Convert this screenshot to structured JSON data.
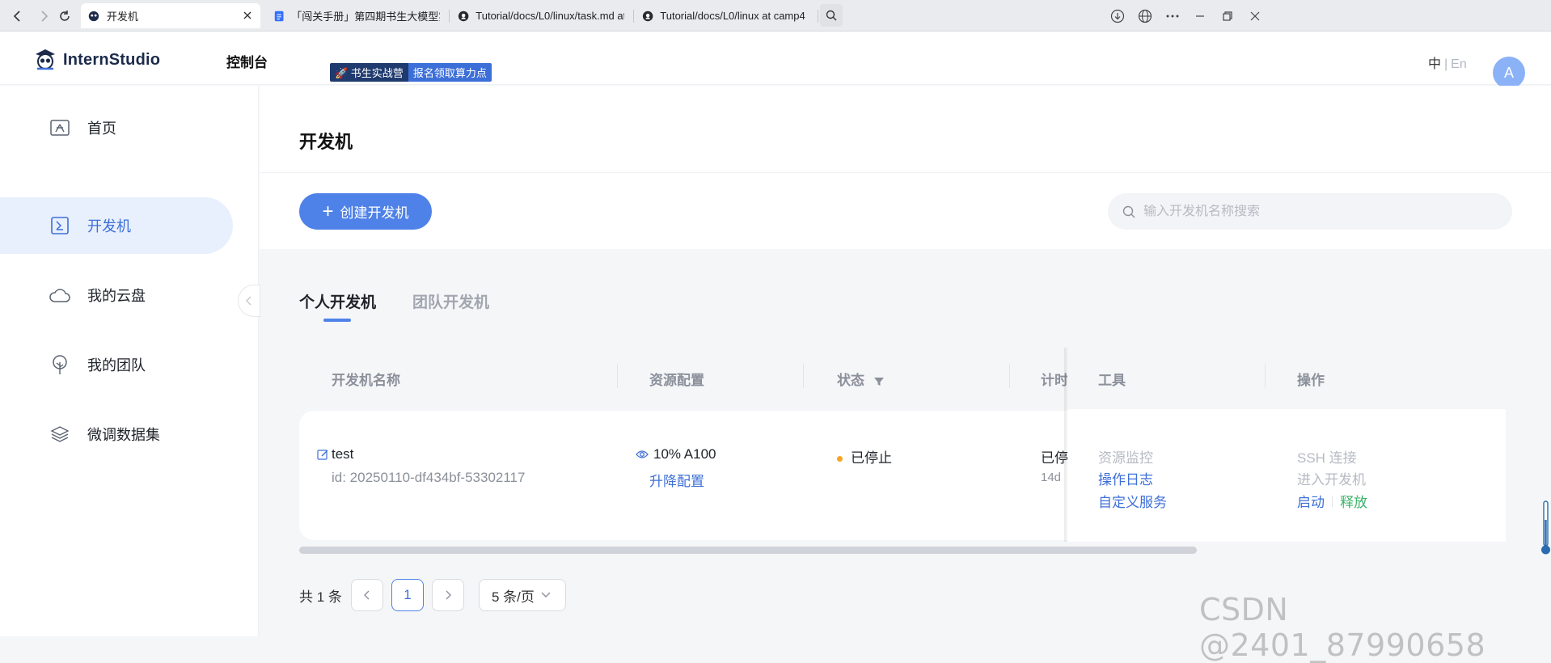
{
  "browser": {
    "tabs": [
      {
        "title": "开发机",
        "active": true
      },
      {
        "title": "「闯关手册」第四期书生大模型实战",
        "active": false
      },
      {
        "title": "Tutorial/docs/L0/linux/task.md at",
        "active": false
      },
      {
        "title": "Tutorial/docs/L0/linux at camp4",
        "active": false
      }
    ]
  },
  "header": {
    "logo_text": "InternStudio",
    "console": "控制台",
    "promo_left": "🚀 书生实战营",
    "promo_right": "报名领取算力点",
    "lang_zh": "中",
    "lang_sep": "|",
    "lang_en": "En",
    "avatar_letter": "A"
  },
  "sidebar": {
    "items": [
      {
        "label": "首页",
        "icon": "home-icon"
      },
      {
        "label": "开发机",
        "icon": "terminal-icon",
        "active": true
      },
      {
        "label": "我的云盘",
        "icon": "cloud-icon"
      },
      {
        "label": "我的团队",
        "icon": "team-icon"
      },
      {
        "label": "微调数据集",
        "icon": "layers-icon"
      }
    ]
  },
  "main": {
    "title": "开发机",
    "create_button": "创建开发机",
    "search_placeholder": "输入开发机名称搜索",
    "tabs": [
      "个人开发机",
      "团队开发机"
    ],
    "columns": [
      "开发机名称",
      "资源配置",
      "状态",
      "计时",
      "工具",
      "操作"
    ],
    "rows": [
      {
        "name": "test",
        "id": "id: 20250110-df434bf-53302117",
        "resource": "10% A100",
        "resource_action": "升降配置",
        "status": "已停止",
        "timer_status": "已停",
        "timer_value": "14d",
        "tools": [
          "资源监控",
          "操作日志",
          "自定义服务"
        ],
        "actions": {
          "ssh": "SSH 连接",
          "enter": "进入开发机",
          "start": "启动",
          "release": "释放"
        }
      }
    ]
  },
  "pagination": {
    "total": "共 1 条",
    "current_page": "1",
    "page_size": "5 条/页"
  },
  "watermark": "CSDN @2401_87990658",
  "colors": {
    "accent": "#4f82e8",
    "status_stopped": "#f5a623",
    "release_green": "#3bb36a"
  }
}
